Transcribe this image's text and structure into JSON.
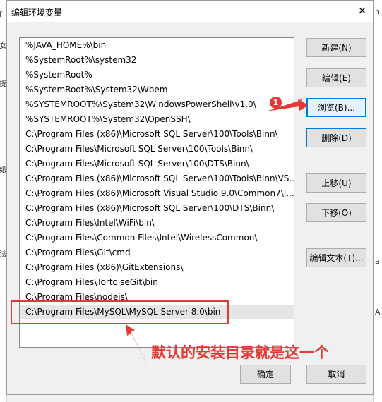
{
  "background": {
    "left_chars": [
      "f",
      "女",
      "提",
      "纸",
      "法"
    ],
    "right_chars": [
      "n",
      "a",
      "A"
    ]
  },
  "dialog": {
    "title": "编辑环境变量",
    "close_glyph": "✕"
  },
  "paths": [
    "%JAVA_HOME%\\bin",
    "%SystemRoot%\\system32",
    "%SystemRoot%",
    "%SystemRoot%\\System32\\Wbem",
    "%SYSTEMROOT%\\System32\\WindowsPowerShell\\v1.0\\",
    "%SYSTEMROOT%\\System32\\OpenSSH\\",
    "C:\\Program Files (x86)\\Microsoft SQL Server\\100\\Tools\\Binn\\",
    "C:\\Program Files\\Microsoft SQL Server\\100\\Tools\\Binn\\",
    "C:\\Program Files\\Microsoft SQL Server\\100\\DTS\\Binn\\",
    "C:\\Program Files (x86)\\Microsoft SQL Server\\100\\Tools\\Binn\\VS...",
    "C:\\Program Files (x86)\\Microsoft Visual Studio 9.0\\Common7\\I...",
    "C:\\Program Files (x86)\\Microsoft SQL Server\\100\\DTS\\Binn\\",
    "C:\\Program Files\\Intel\\WiFi\\bin\\",
    "C:\\Program Files\\Common Files\\Intel\\WirelessCommon\\",
    "C:\\Program Files\\Git\\cmd",
    "C:\\Program Files (x86)\\GitExtensions\\",
    "C:\\Program Files\\TortoiseGit\\bin",
    "C:\\Program Files\\nodejs\\",
    "C:\\Program Files\\MySQL\\MySQL Server 8.0\\bin"
  ],
  "selected_index": 18,
  "buttons": {
    "new": "新建(N)",
    "edit": "编辑(E)",
    "browse": "浏览(B)...",
    "delete": "删除(D)",
    "move_up": "上移(U)",
    "move_down": "下移(O)",
    "edit_text": "编辑文本(T)...",
    "ok": "确定",
    "cancel": "取消"
  },
  "annotations": {
    "badge": "1",
    "caption": "默认的安装目录就是这一个",
    "color": "#e53935"
  }
}
